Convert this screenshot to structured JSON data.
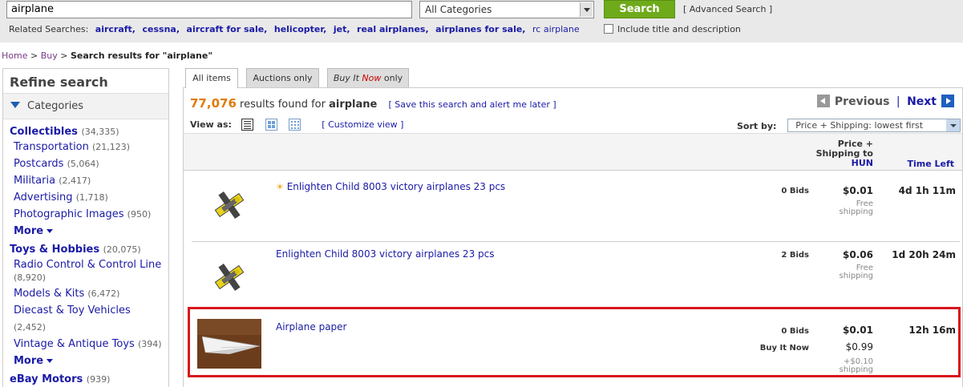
{
  "search": {
    "query": "airplane",
    "category": "All Categories",
    "button": "Search",
    "advanced": "[ Advanced Search ]",
    "include_label": "Include title and description"
  },
  "related": {
    "label": "Related Searches:",
    "terms": [
      "aircraft,",
      "cessna,",
      "aircraft for sale,",
      "helicopter,",
      "jet,",
      "real airplanes,",
      "airplanes for sale,",
      "rc airplane"
    ]
  },
  "breadcrumb": {
    "home": "Home",
    "sep1": " > ",
    "buy": "Buy",
    "sep2": " > ",
    "current": "Search results for \"airplane\""
  },
  "refine": {
    "title": "Refine search",
    "categories_label": "Categories",
    "groups": [
      {
        "name": "Collectibles",
        "count": "(34,335)",
        "subs": [
          {
            "name": "Transportation",
            "count": "(21,123)"
          },
          {
            "name": "Postcards",
            "count": "(5,064)"
          },
          {
            "name": "Militaria",
            "count": "(2,417)"
          },
          {
            "name": "Advertising",
            "count": "(1,718)"
          },
          {
            "name": "Photographic Images",
            "count": "(950)"
          }
        ],
        "more": "More"
      },
      {
        "name": "Toys & Hobbies",
        "count": "(20,075)",
        "subs": [
          {
            "name": "Radio Control & Control Line",
            "count": "(8,920)"
          },
          {
            "name": "Models & Kits",
            "count": "(6,472)"
          },
          {
            "name": "Diecast & Toy Vehicles",
            "count": "(2,452)"
          },
          {
            "name": "Vintage & Antique Toys",
            "count": "(394)"
          }
        ],
        "more": "More"
      },
      {
        "name": "eBay Motors",
        "count": "(939)"
      }
    ]
  },
  "tabs": {
    "all": "All items",
    "auctions": "Auctions only",
    "bin_prefix": "Buy It ",
    "bin_now": "Now",
    "bin_suffix": " only"
  },
  "results": {
    "count": "77,076",
    "found_text": " results found for ",
    "query": "airplane",
    "save_link": "[ Save this search and alert me later ]",
    "previous": "Previous",
    "separator": "|",
    "next": "Next",
    "view_as": "View as:",
    "customize": "[ Customize view ]",
    "sort_label": "Sort by:",
    "sort_value": "Price + Shipping: lowest first",
    "col_price_line1": "Price +",
    "col_price_line2": "Shipping to",
    "col_price_line3": "HUN",
    "col_time": "Time Left"
  },
  "items": [
    {
      "title": "Enlighten Child 8003 victory airplanes 23 pcs",
      "bids": "0 Bids",
      "price": "$0.01",
      "shipping_line1": "Free",
      "shipping_line2": "shipping",
      "time_left": "4d 1h 11m",
      "thumb_icon": "toy-plane-image"
    },
    {
      "title": "Enlighten Child 8003 victory airplanes 23 pcs",
      "bids": "2 Bids",
      "price": "$0.06",
      "shipping_line1": "Free",
      "shipping_line2": "shipping",
      "time_left": "1d 20h 24m",
      "thumb_icon": "toy-plane-image"
    },
    {
      "title": "Airplane paper",
      "bids": "0 Bids",
      "price": "$0.01",
      "bin_label": "Buy It Now",
      "bin_price": "$0.99",
      "shipping_line1": "+$0.10",
      "shipping_line2": "shipping",
      "time_left": "12h 16m",
      "thumb_icon": "paper-airplane-image"
    }
  ],
  "colors": {
    "search_button": "#6faa1b",
    "result_count": "#e07b0c",
    "link": "#1a1aa6",
    "highlight_border": "#d9141c"
  }
}
